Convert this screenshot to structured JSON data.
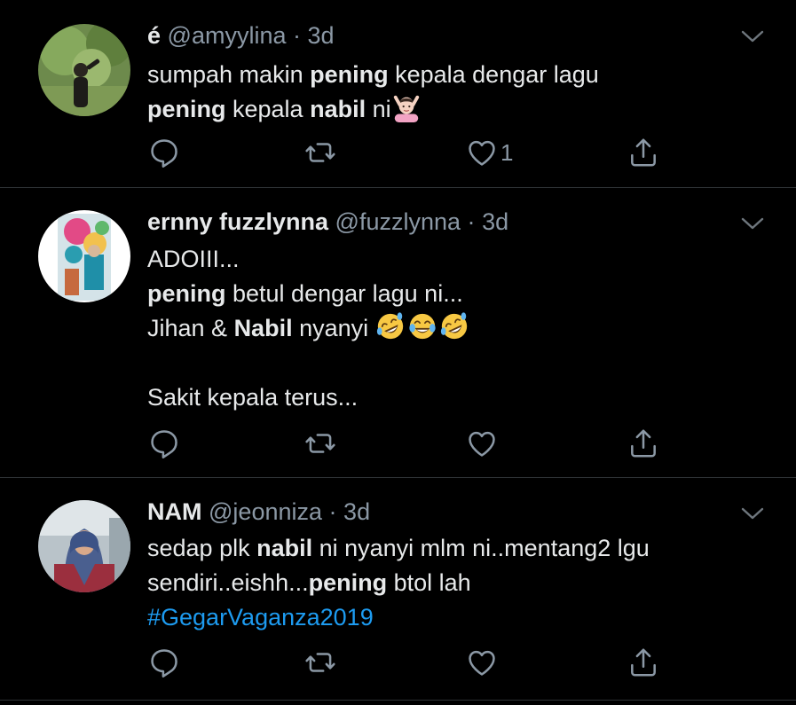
{
  "tweets": [
    {
      "name": "é",
      "handle": "@amyylina",
      "separator": "·",
      "time": "3d",
      "lines": [
        [
          {
            "t": "sumpah makin "
          },
          {
            "t": "pening",
            "b": true
          },
          {
            "t": " kepala dengar lagu"
          }
        ],
        [
          {
            "t": "pening",
            "b": true
          },
          {
            "t": " kepala "
          },
          {
            "t": "nabil",
            "b": true
          },
          {
            "t": " ni"
          }
        ]
      ],
      "trailing_emoji": [
        "woman-gesturing-ok-emoji"
      ],
      "like_count": "1"
    },
    {
      "name": "ernny fuzzlynna",
      "handle": "@fuzzlynna",
      "separator": "·",
      "time": "3d",
      "lines": [
        [
          {
            "t": "ADOIII..."
          }
        ],
        [
          {
            "t": "pening",
            "b": true
          },
          {
            "t": " betul dengar lagu ni..."
          }
        ],
        [
          {
            "t": "Jihan & "
          },
          {
            "t": "Nabil",
            "b": true
          },
          {
            "t": " nyanyi "
          }
        ],
        [],
        [
          {
            "t": "Sakit kepala terus..."
          }
        ]
      ],
      "trailing_emoji_line": 2,
      "trailing_emoji": [
        "rolling-on-floor-laughing-emoji",
        "tears-of-joy-emoji",
        "rolling-on-floor-laughing-emoji"
      ],
      "like_count": ""
    },
    {
      "name": "NAM",
      "handle": "@jeonniza",
      "separator": "·",
      "time": "3d",
      "lines": [
        [
          {
            "t": "sedap plk "
          },
          {
            "t": "nabil",
            "b": true
          },
          {
            "t": " ni nyanyi mlm ni..mentang2 lgu"
          }
        ],
        [
          {
            "t": "sendiri..eishh..."
          },
          {
            "t": "pening",
            "b": true
          },
          {
            "t": " btol lah"
          }
        ],
        [
          {
            "t": "#GegarVaganza2019",
            "h": true
          }
        ]
      ],
      "like_count": ""
    }
  ],
  "icons": {
    "reply": "reply-icon",
    "retweet": "retweet-icon",
    "like": "heart-icon",
    "share": "share-icon",
    "more": "chevron-down-icon"
  },
  "colors": {
    "background": "#000000",
    "text": "#e7e9ea",
    "secondary": "#8b98a5",
    "link": "#1d9bf0",
    "divider": "#2f3336"
  }
}
